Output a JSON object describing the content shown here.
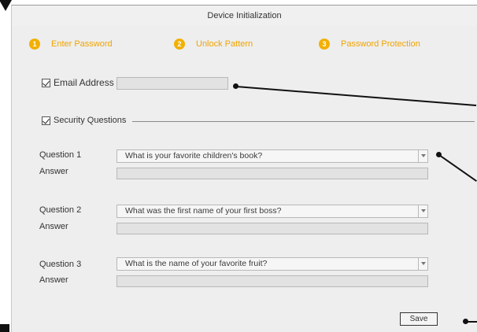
{
  "dialog": {
    "title": "Device Initialization"
  },
  "steps": [
    {
      "number": "1",
      "label": "Enter Password"
    },
    {
      "number": "2",
      "label": "Unlock Pattern"
    },
    {
      "number": "3",
      "label": "Password Protection"
    }
  ],
  "email": {
    "label": "Email Address",
    "value": "",
    "checked": true
  },
  "security": {
    "label": "Security Questions",
    "checked": true
  },
  "questions": [
    {
      "label": "Question 1",
      "value": "What is your favorite children's book?",
      "answer_label": "Answer",
      "answer": ""
    },
    {
      "label": "Question 2",
      "value": "What was the first name of your first boss?",
      "answer_label": "Answer",
      "answer": ""
    },
    {
      "label": "Question 3",
      "value": "What is the name of your favorite fruit?",
      "answer_label": "Answer",
      "answer": ""
    }
  ],
  "actions": {
    "save_label": "Save"
  },
  "icons": {
    "checkbox": "checkmark-icon",
    "dropdown": "chevron-down-icon"
  },
  "colors": {
    "step_accent": "#f2b000",
    "step_text": "#f0a400"
  }
}
